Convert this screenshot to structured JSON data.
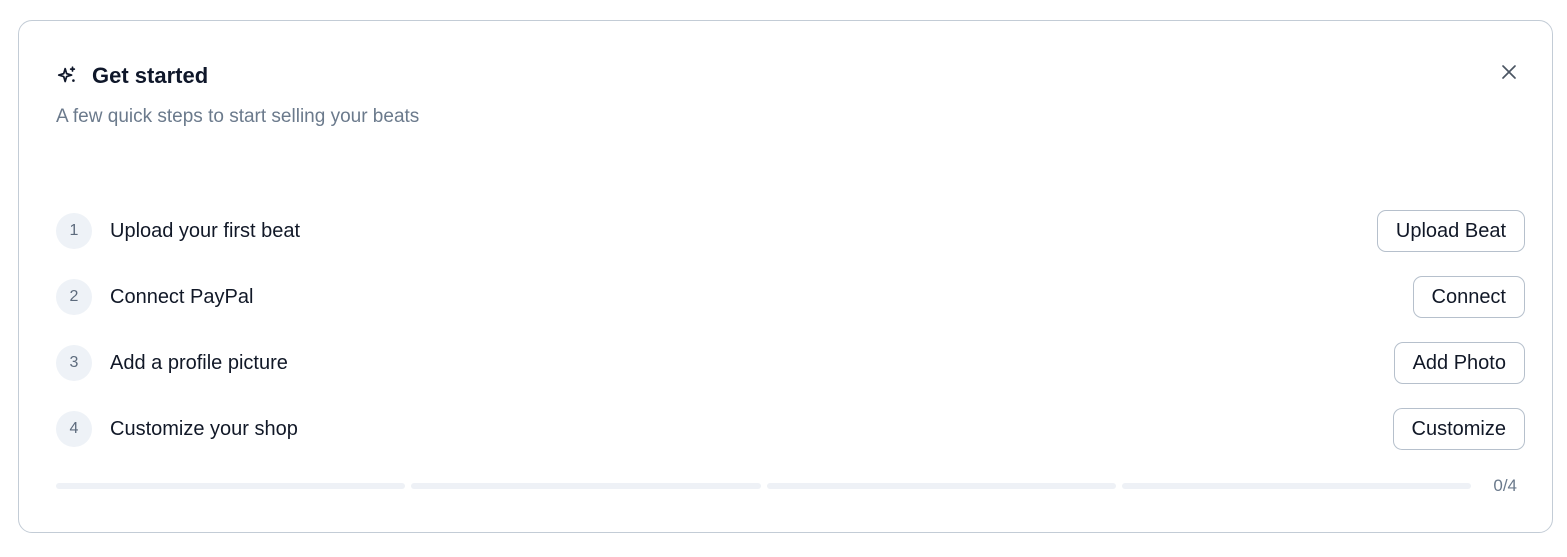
{
  "header": {
    "title": "Get started",
    "subtitle": "A few quick steps to start selling your beats",
    "icon": "sparkles-icon",
    "close_icon": "close-icon"
  },
  "steps": [
    {
      "number": "1",
      "label": "Upload your first beat",
      "button": "Upload Beat"
    },
    {
      "number": "2",
      "label": "Connect PayPal",
      "button": "Connect"
    },
    {
      "number": "3",
      "label": "Add a profile picture",
      "button": "Add Photo"
    },
    {
      "number": "4",
      "label": "Customize your shop",
      "button": "Customize"
    }
  ],
  "progress": {
    "completed": 0,
    "total": 4,
    "text": "0/4"
  },
  "colors": {
    "border": "#c3ccd6",
    "muted_text": "#6b7a8c",
    "progress_track": "#eef1f6"
  }
}
